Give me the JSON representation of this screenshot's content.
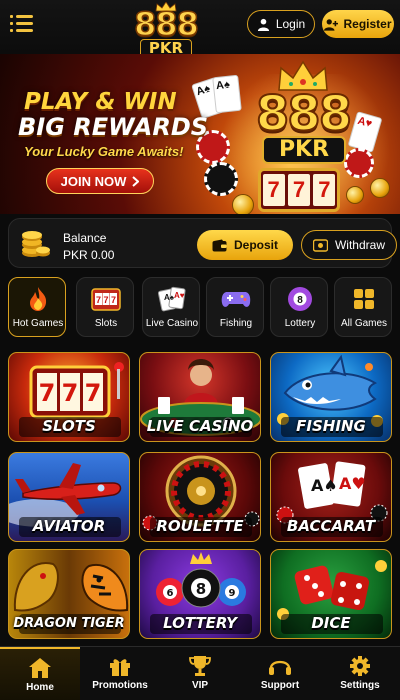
{
  "header": {
    "logo_line1": "888",
    "logo_line2": "PKR",
    "login_label": "Login",
    "register_label": "Register"
  },
  "banner": {
    "headline_1": "PLAY & WIN",
    "headline_2": "BIG REWARDS",
    "tagline": "Your Lucky Game Awaits!",
    "cta_label": "JOIN NOW",
    "logo_line1": "888",
    "logo_line2": "PKR",
    "reels": [
      "7",
      "7",
      "7"
    ]
  },
  "wallet": {
    "label": "Balance",
    "value": "PKR 0.00",
    "deposit_label": "Deposit",
    "withdraw_label": "Withdraw"
  },
  "categories": [
    {
      "label": "Hot Games",
      "icon": "flame-icon",
      "active": true
    },
    {
      "label": "Slots",
      "icon": "slot-machine-icon"
    },
    {
      "label": "Live Casino",
      "icon": "playing-cards-icon"
    },
    {
      "label": "Fishing",
      "icon": "gamepad-icon"
    },
    {
      "label": "Lottery",
      "icon": "lottery-ball-icon"
    },
    {
      "label": "All Games",
      "icon": "grid-icon"
    }
  ],
  "games": [
    {
      "label": "SLOTS",
      "theme": "#c82a0c"
    },
    {
      "label": "LIVE CASINO",
      "theme": "#7a0e12"
    },
    {
      "label": "FISHING",
      "theme": "#0d6ac4"
    },
    {
      "label": "AVIATOR",
      "theme": "#1b4fb0"
    },
    {
      "label": "ROULETTE",
      "theme": "#5a0808"
    },
    {
      "label": "BACCARAT",
      "theme": "#6a0b0b"
    },
    {
      "label": "DRAGON TIGER",
      "theme": "#9a5a08"
    },
    {
      "label": "LOTTERY",
      "theme": "#5a1fa0"
    },
    {
      "label": "DICE",
      "theme": "#0f6e22"
    }
  ],
  "bottom_nav": [
    {
      "label": "Home",
      "icon": "home-icon",
      "active": true
    },
    {
      "label": "Promotions",
      "icon": "gift-icon"
    },
    {
      "label": "VIP",
      "icon": "trophy-icon"
    },
    {
      "label": "Support",
      "icon": "headset-icon"
    },
    {
      "label": "Settings",
      "icon": "gear-icon"
    }
  ],
  "colors": {
    "accent_gold": "#f0b72a",
    "background": "#0b0b0b",
    "cta_red": "#d22a16"
  }
}
